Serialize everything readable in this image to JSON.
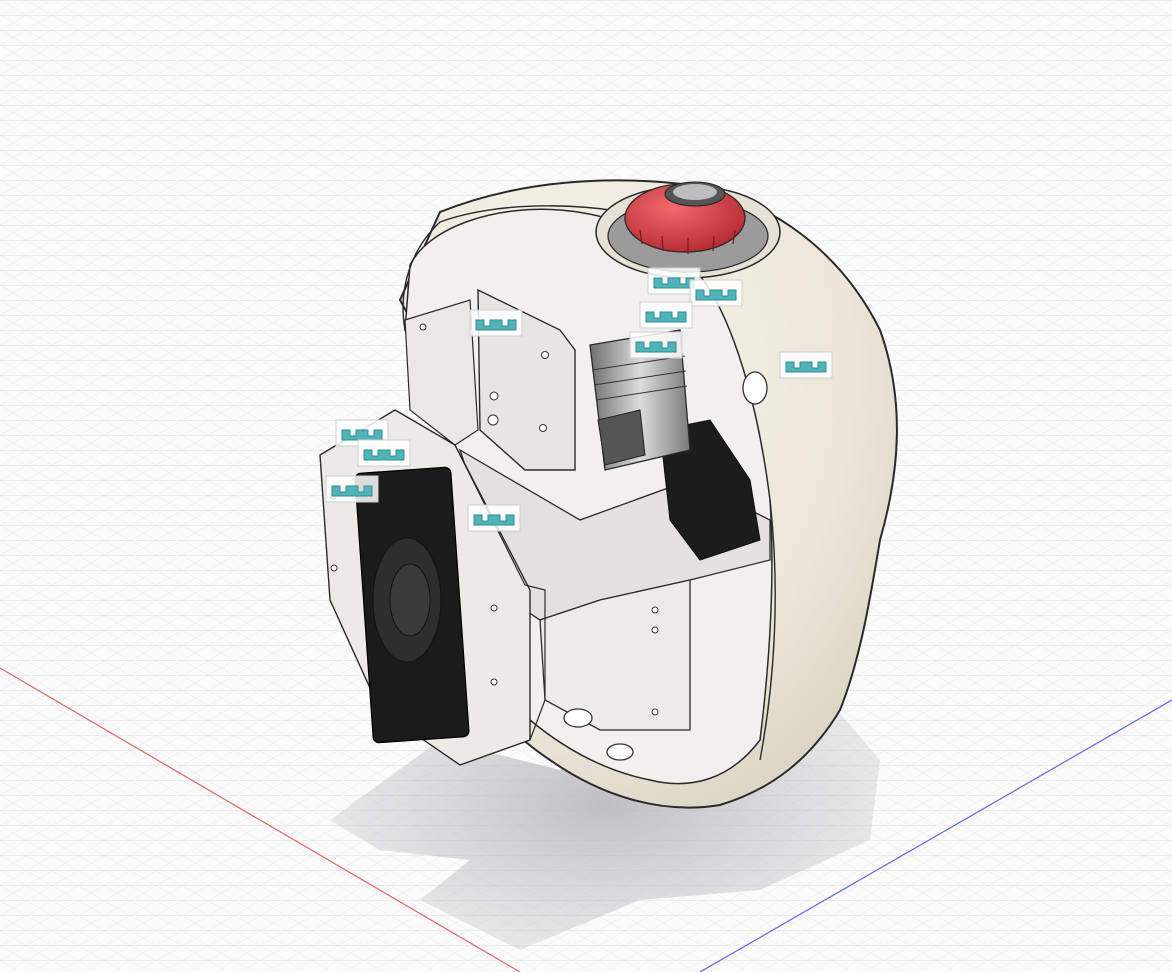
{
  "viewport": {
    "name": "3d-model-viewport",
    "background": "#fbfbfb",
    "grid_color": "#d9d9d9",
    "x_axis_color": "#e06b6b",
    "y_axis_color": "#6b6be0"
  },
  "model": {
    "body_color": "#efeadd",
    "outline_color": "#2a2a2a",
    "button_color": "#d6393f",
    "speaker_color": "#1b1b1b",
    "bracket_color": "#e4e3e0"
  },
  "joint_glyph": {
    "icon": "joint-icon",
    "color": "#4fb3b9",
    "count": 9
  }
}
